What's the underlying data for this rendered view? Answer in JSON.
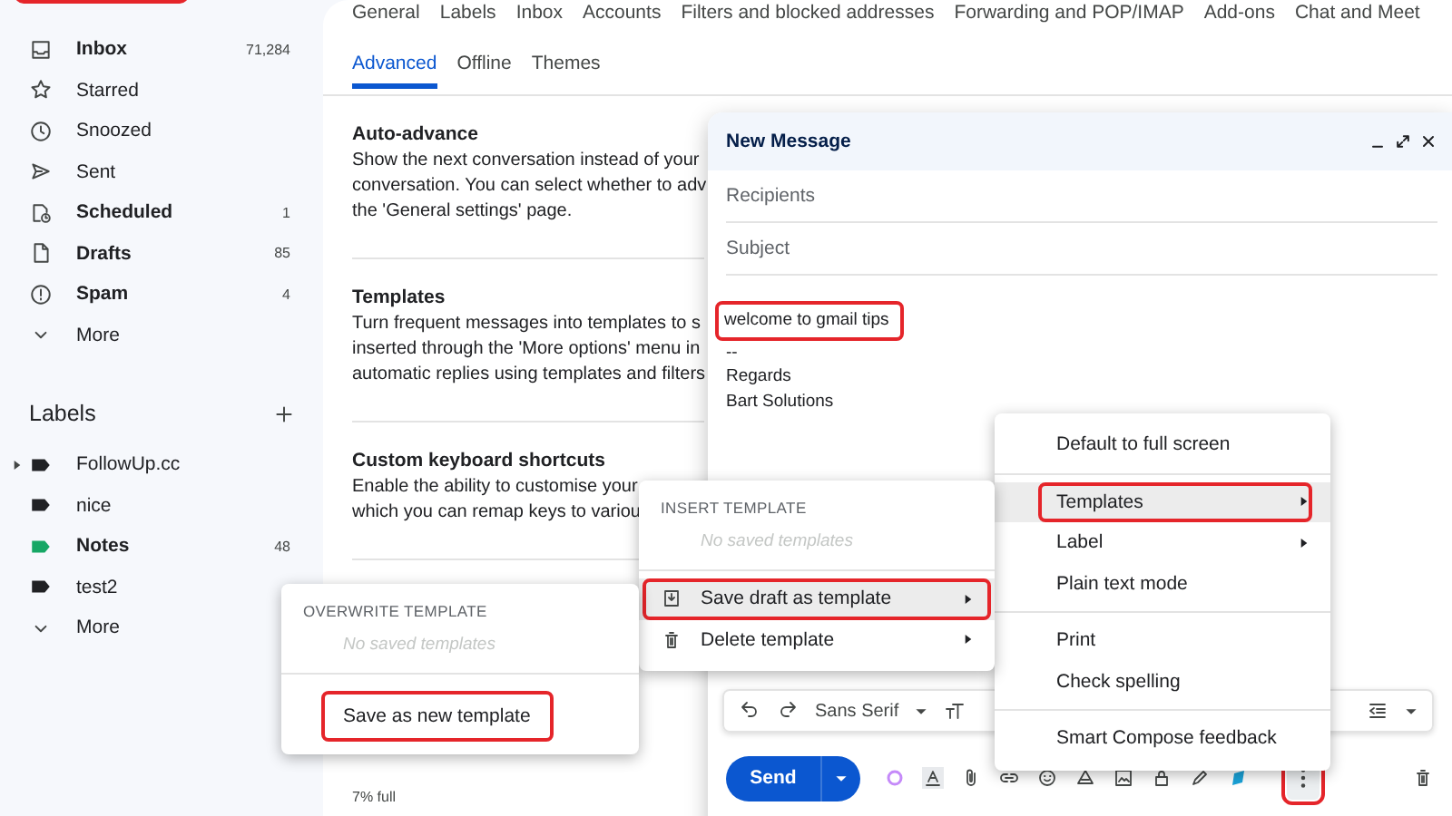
{
  "sidebar": {
    "compose_highlighted": true,
    "items": [
      {
        "kind": "inbox",
        "label": "Inbox",
        "count": "71,284",
        "bold": true
      },
      {
        "kind": "star",
        "label": "Starred",
        "bold": false
      },
      {
        "kind": "clock",
        "label": "Snoozed",
        "bold": false
      },
      {
        "kind": "sent",
        "label": "Sent",
        "bold": false
      },
      {
        "kind": "scheduled",
        "label": "Scheduled",
        "count": "1",
        "bold": true
      },
      {
        "kind": "draft",
        "label": "Drafts",
        "count": "85",
        "bold": true
      },
      {
        "kind": "spam",
        "label": "Spam",
        "count": "4",
        "bold": true
      },
      {
        "kind": "more",
        "label": "More",
        "bold": false
      }
    ],
    "labels_heading": "Labels",
    "labels": [
      {
        "name": "FollowUp.cc",
        "color": "#202124",
        "bold": false,
        "expandable": true
      },
      {
        "name": "nice",
        "color": "#202124",
        "bold": false,
        "expandable": false
      },
      {
        "name": "Notes",
        "color": "#16a765",
        "count": "48",
        "bold": true,
        "expandable": false
      },
      {
        "name": "test2",
        "color": "#202124",
        "bold": false,
        "expandable": false
      }
    ],
    "labels_more": "More"
  },
  "settings_tabs": [
    [
      {
        "label": "General",
        "selected": false
      },
      {
        "label": "Labels",
        "selected": false
      },
      {
        "label": "Inbox",
        "selected": false
      },
      {
        "label": "Accounts",
        "selected": false
      },
      {
        "label": "Filters and blocked addresses",
        "selected": false
      },
      {
        "label": "Forwarding and POP/IMAP",
        "selected": false
      },
      {
        "label": "Add-ons",
        "selected": false
      },
      {
        "label": "Chat and Meet",
        "selected": false
      }
    ],
    [
      {
        "label": "Advanced",
        "selected": true
      },
      {
        "label": "Offline",
        "selected": false
      },
      {
        "label": "Themes",
        "selected": false
      }
    ]
  ],
  "sections": [
    {
      "title": "Auto-advance",
      "lines": [
        "Show the next conversation instead of your",
        "conversation. You can select whether to adv",
        "the 'General settings' page."
      ]
    },
    {
      "title": "Templates",
      "lines": [
        "Turn frequent messages into templates to s",
        "inserted through the 'More options' menu in",
        "automatic replies using templates and filters"
      ]
    },
    {
      "title": "Custom keyboard shortcuts",
      "lines": [
        "Enable the ability to customise your",
        "which you can remap keys to variou"
      ]
    }
  ],
  "storage": "7% full",
  "compose": {
    "title": "New Message",
    "recipients_placeholder": "Recipients",
    "subject_placeholder": "Subject",
    "body": [
      {
        "text": "welcome to gmail tips",
        "highlighted": true
      },
      {
        "text": "--",
        "highlighted": false
      },
      {
        "text": "Regards",
        "highlighted": false
      },
      {
        "text": "Bart Solutions",
        "highlighted": false
      }
    ],
    "font": "Sans Serif",
    "send": "Send",
    "more_highlighted": true
  },
  "more_menu": [
    [
      {
        "label": "Default to full screen",
        "submenu": false,
        "selected": false,
        "highlighted": false
      }
    ],
    [
      {
        "label": "Templates",
        "submenu": true,
        "selected": true,
        "highlighted": true
      },
      {
        "label": "Label",
        "submenu": true,
        "selected": false,
        "highlighted": false
      },
      {
        "label": "Plain text mode",
        "submenu": false,
        "selected": false,
        "highlighted": false
      }
    ],
    [
      {
        "label": "Print",
        "submenu": false,
        "selected": false,
        "highlighted": false
      },
      {
        "label": "Check spelling",
        "submenu": false,
        "selected": false,
        "highlighted": false
      }
    ],
    [
      {
        "label": "Smart Compose feedback",
        "submenu": false,
        "selected": false,
        "highlighted": false
      }
    ]
  ],
  "templates_menu": {
    "heading": "INSERT TEMPLATE",
    "empty": "No saved templates",
    "items": [
      {
        "kind": "save",
        "label": "Save draft as template",
        "selected": true,
        "highlighted": true
      },
      {
        "kind": "delete",
        "label": "Delete template",
        "selected": false,
        "highlighted": false
      }
    ]
  },
  "overwrite_menu": {
    "heading": "OVERWRITE TEMPLATE",
    "empty": "No saved templates",
    "items": [
      {
        "label": "Save as new template",
        "selected": false,
        "highlighted": true
      }
    ]
  }
}
